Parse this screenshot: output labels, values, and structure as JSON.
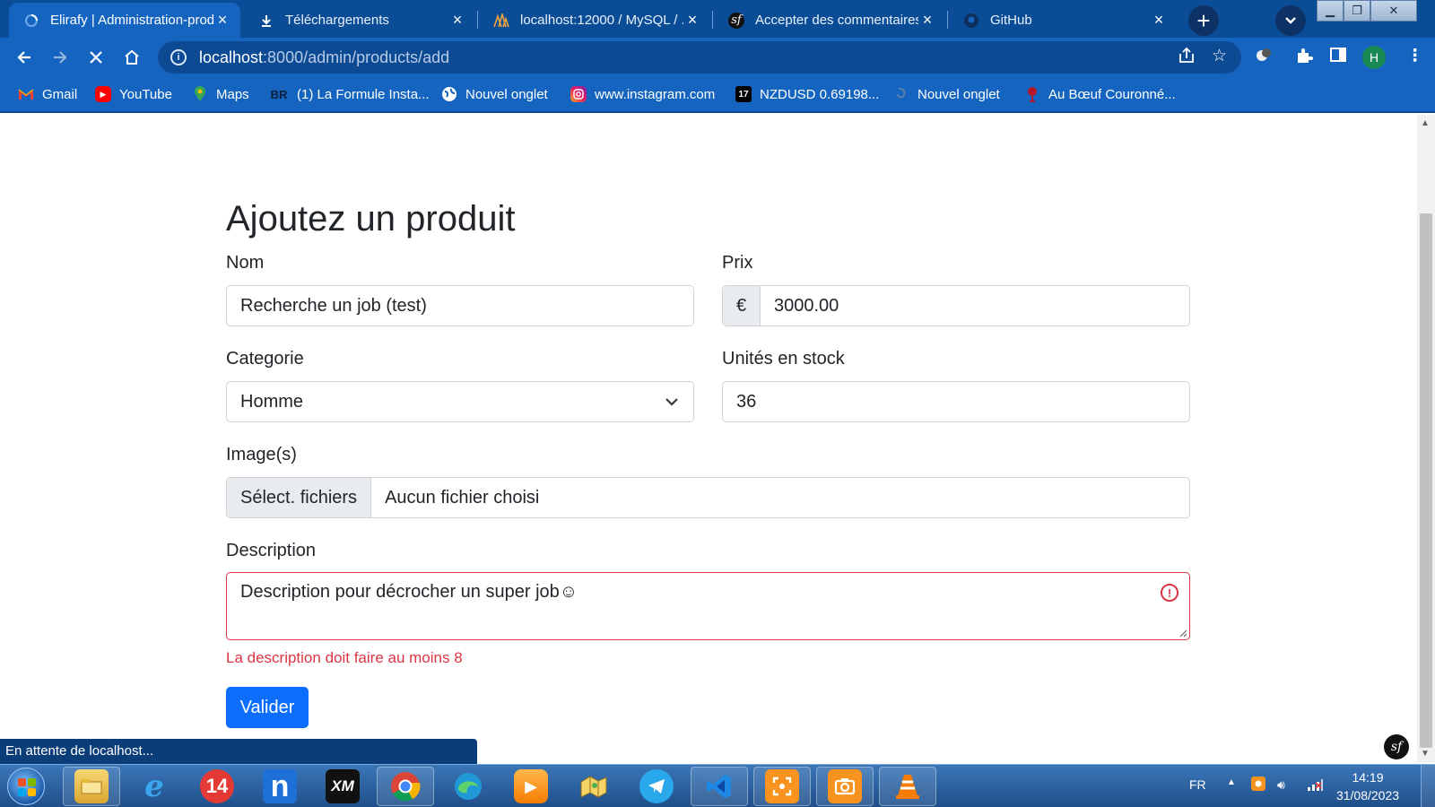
{
  "browser": {
    "tabs": [
      {
        "title": "Elirafy | Administration-produits",
        "icon": "loading-spinner-icon",
        "active": true
      },
      {
        "title": "Téléchargements",
        "icon": "download-icon",
        "active": false
      },
      {
        "title": "localhost:12000 / MySQL / ...",
        "icon": "phpmyadmin-icon",
        "active": false
      },
      {
        "title": "Accepter des commentaires",
        "icon": "symfony-icon",
        "active": false
      },
      {
        "title": "GitHub",
        "icon": "github-icon",
        "active": false
      }
    ],
    "url_host": "localhost",
    "url_path": ":8000/admin/products/add",
    "profile_initial": "H",
    "bookmarks": [
      {
        "label": "Gmail",
        "icon": "gmail-icon"
      },
      {
        "label": "YouTube",
        "icon": "youtube-icon"
      },
      {
        "label": "Maps",
        "icon": "maps-icon"
      },
      {
        "label": "(1) La Formule Insta...",
        "icon": "br-icon",
        "icon_text": "BR"
      },
      {
        "label": "Nouvel onglet",
        "icon": "globe-icon"
      },
      {
        "label": "www.instagram.com",
        "icon": "instagram-icon"
      },
      {
        "label": "NZDUSD 0.69198...",
        "icon": "tradingview-icon"
      },
      {
        "label": "Nouvel onglet",
        "icon": "page-icon"
      },
      {
        "label": "Au Bœuf Couronné...",
        "icon": "restaurant-icon"
      }
    ],
    "status_text": "En attente de localhost..."
  },
  "form": {
    "title": "Ajoutez un produit",
    "name_label": "Nom",
    "name_value": "Recherche un job (test)",
    "price_label": "Prix",
    "price_prefix": "€",
    "price_value": "3000.00",
    "category_label": "Categorie",
    "category_value": "Homme",
    "stock_label": "Unités en stock",
    "stock_value": "36",
    "images_label": "Image(s)",
    "file_button": "Sélect. fichiers",
    "file_status": "Aucun fichier choisi",
    "description_label": "Description",
    "description_value": "Description pour décrocher un super job☺",
    "description_error": "La description doit faire au moins 8",
    "submit_label": "Valider"
  },
  "taskbar": {
    "apps": [
      "file-explorer-icon",
      "internet-explorer-icon",
      "app-14-icon",
      "n-app-icon",
      "xm-icon",
      "chrome-icon",
      "edge-icon",
      "media-player-icon",
      "maps-app-icon",
      "telegram-icon",
      "vscode-icon",
      "screenshot-icon",
      "camera-icon",
      "vlc-icon"
    ],
    "app_14_text": "14",
    "xm_text": "XM",
    "n_text": "n",
    "language": "FR",
    "time": "14:19",
    "date": "31/08/2023"
  },
  "colors": {
    "chrome_dark": "#0a4d96",
    "chrome": "#1565c0",
    "primary": "#0d6efd",
    "danger": "#dc3545"
  }
}
